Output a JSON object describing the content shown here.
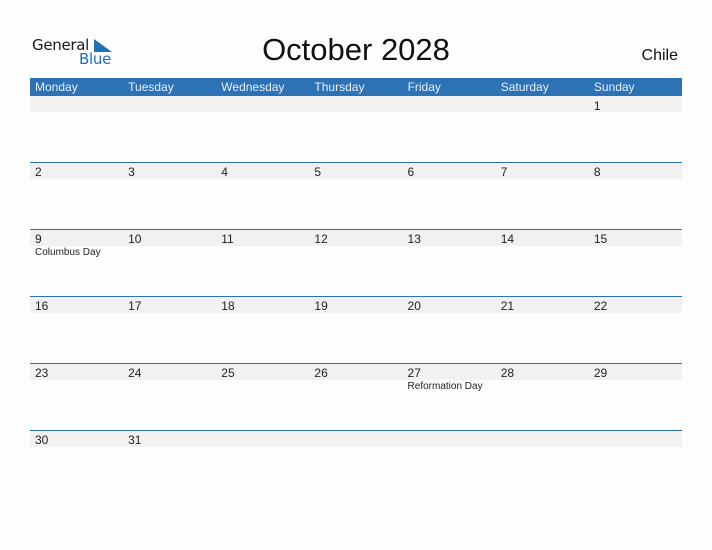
{
  "logo": {
    "line1": "General",
    "line2": "Blue"
  },
  "title": "October 2028",
  "country": "Chile",
  "colors": {
    "accent": "#2e72b6",
    "band": "#f1f1f1"
  },
  "weekdays": [
    "Monday",
    "Tuesday",
    "Wednesday",
    "Thursday",
    "Friday",
    "Saturday",
    "Sunday"
  ],
  "weeks": [
    [
      {
        "day": ""
      },
      {
        "day": ""
      },
      {
        "day": ""
      },
      {
        "day": ""
      },
      {
        "day": ""
      },
      {
        "day": ""
      },
      {
        "day": "1"
      }
    ],
    [
      {
        "day": "2"
      },
      {
        "day": "3"
      },
      {
        "day": "4"
      },
      {
        "day": "5"
      },
      {
        "day": "6"
      },
      {
        "day": "7"
      },
      {
        "day": "8"
      }
    ],
    [
      {
        "day": "9",
        "holiday": "Columbus Day"
      },
      {
        "day": "10"
      },
      {
        "day": "11"
      },
      {
        "day": "12"
      },
      {
        "day": "13"
      },
      {
        "day": "14"
      },
      {
        "day": "15"
      }
    ],
    [
      {
        "day": "16"
      },
      {
        "day": "17"
      },
      {
        "day": "18"
      },
      {
        "day": "19"
      },
      {
        "day": "20"
      },
      {
        "day": "21"
      },
      {
        "day": "22"
      }
    ],
    [
      {
        "day": "23"
      },
      {
        "day": "24"
      },
      {
        "day": "25"
      },
      {
        "day": "26"
      },
      {
        "day": "27",
        "holiday": "Reformation Day"
      },
      {
        "day": "28"
      },
      {
        "day": "29"
      }
    ],
    [
      {
        "day": "30"
      },
      {
        "day": "31"
      },
      {
        "day": ""
      },
      {
        "day": ""
      },
      {
        "day": ""
      },
      {
        "day": ""
      },
      {
        "day": ""
      }
    ]
  ]
}
